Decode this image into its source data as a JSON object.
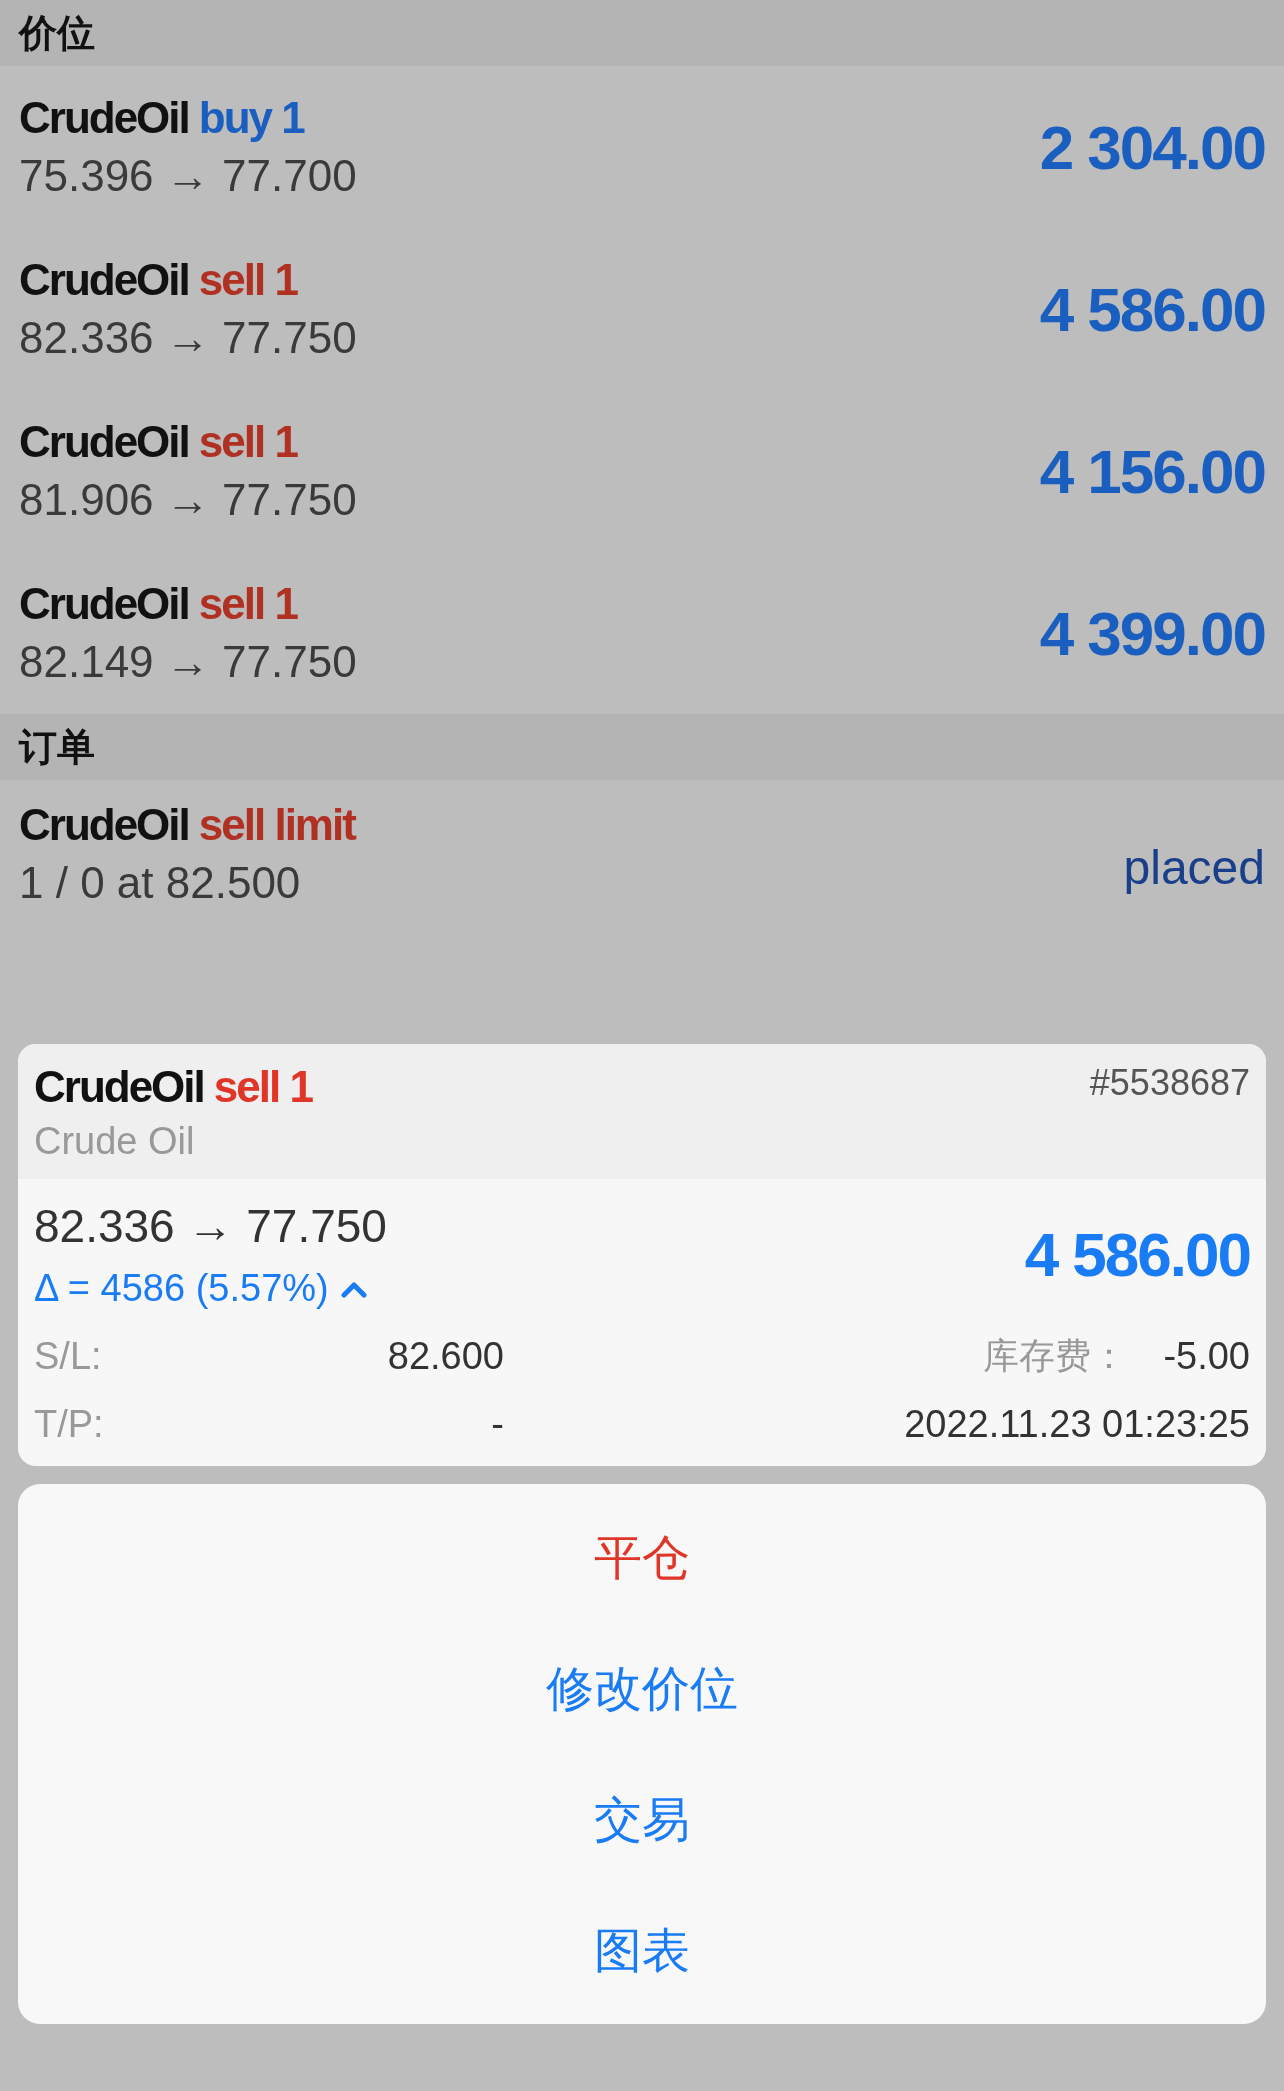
{
  "positions_section": {
    "title": "价位",
    "positions": [
      {
        "symbol": "CrudeOil",
        "color": "#1a5fc0",
        "type_label": "buy 1",
        "prices": "75.396 → 77.700",
        "profit": "2 304.00"
      },
      {
        "symbol": "CrudeOil",
        "color": "#b03022",
        "type_label": "sell 1",
        "prices": "82.336 → 77.750",
        "profit": "4 586.00"
      },
      {
        "symbol": "CrudeOil",
        "color": "#b03022",
        "type_label": "sell 1",
        "prices": "81.906 → 77.750",
        "profit": "4 156.00"
      },
      {
        "symbol": "CrudeOil",
        "color": "#b03022",
        "type_label": "sell 1",
        "prices": "82.149 → 77.750",
        "profit": "4 399.00"
      }
    ]
  },
  "orders_section": {
    "title": "订单",
    "orders": [
      {
        "symbol": "CrudeOil",
        "color": "#b03022",
        "type_label": "sell limit",
        "detail": "1 / 0 at 82.500",
        "status": "placed"
      }
    ]
  },
  "detail_card": {
    "symbol": "CrudeOil",
    "color": "#e0362a",
    "type_label": "sell 1",
    "description": "Crude Oil",
    "ticket": "#5538687",
    "prices": "82.336 → 77.750",
    "profit": "4 586.00",
    "delta": "Δ = 4586 (5.57%)",
    "expanded": true,
    "sl_label": "S/L:",
    "sl_value": "82.600",
    "swap_label": "库存费：",
    "swap_value": "-5.00",
    "tp_label": "T/P:",
    "tp_value": "-",
    "time": "2022.11.23 01:23:25"
  },
  "actions": [
    {
      "label": "平仓",
      "kind": "destructive"
    },
    {
      "label": "修改价位",
      "kind": "default"
    },
    {
      "label": "交易",
      "kind": "default"
    },
    {
      "label": "图表",
      "kind": "default"
    }
  ]
}
